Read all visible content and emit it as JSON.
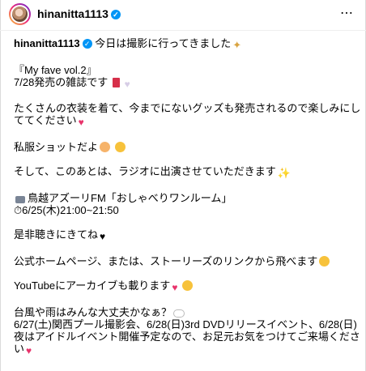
{
  "header": {
    "username": "hinanitta1113",
    "verified_icon": "verified-badge-icon",
    "more_label": "⋯"
  },
  "caption": {
    "username": "hinanitta1113",
    "lines": [
      "今日は撮影に行ってきました",
      "『My fave vol.2』",
      "7/28発売の雑誌です",
      "たくさんの衣装を着て、今までにないグッズも発売されるので楽しみにし",
      "ててください",
      "私服ショットだよ",
      "そして、このあとは、ラジオに出演させていただきます",
      "鳥越アズーリFM「おしゃべりワンルーム」",
      "6/25(木)21:00~21:50",
      "是非聴きにきてね",
      "公式ホームページ、または、ストーリーズのリンクから飛べます",
      "YouTubeにアーカイブも載ります",
      "台風や雨はみんな大丈夫かなぁ？",
      "6/27(土)関西プール撮影会、6/28(日)3rd DVDリリースイベント、6/28(日)",
      "夜はアイドルイベント開催予定なので、お足元お気をつけてご来場くださ",
      "い"
    ]
  },
  "colors": {
    "verified": "#0095f6",
    "heart_pink": "#e8336b",
    "border": "#dbdbdb"
  }
}
